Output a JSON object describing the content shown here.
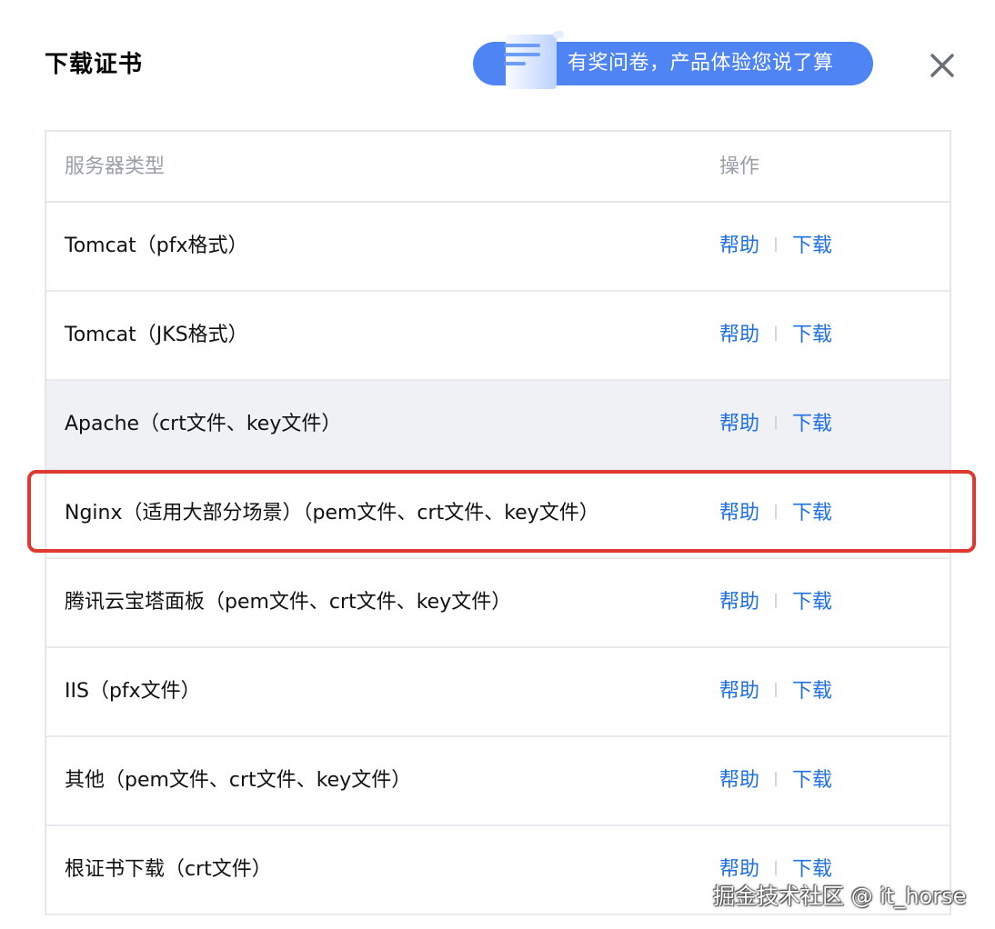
{
  "dialog": {
    "title": "下载证书",
    "survey_banner": "有奖问卷，产品体验您说了算",
    "close_icon": "close-icon"
  },
  "table": {
    "headers": {
      "server_type": "服务器类型",
      "action": "操作"
    },
    "rows": [
      {
        "name": "Tomcat（pfx格式）",
        "help": "帮助",
        "download": "下载"
      },
      {
        "name": "Tomcat（JKS格式）",
        "help": "帮助",
        "download": "下载"
      },
      {
        "name": "Apache（crt文件、key文件）",
        "help": "帮助",
        "download": "下载"
      },
      {
        "name": "Nginx（适用大部分场景）（pem文件、crt文件、key文件）",
        "help": "帮助",
        "download": "下载"
      },
      {
        "name": "腾讯云宝塔面板（pem文件、crt文件、key文件）",
        "help": "帮助",
        "download": "下载"
      },
      {
        "name": "IIS（pfx文件）",
        "help": "帮助",
        "download": "下载"
      },
      {
        "name": "其他（pem文件、crt文件、key文件）",
        "help": "帮助",
        "download": "下载"
      },
      {
        "name": "根证书下载（crt文件）",
        "help": "帮助",
        "download": "下载"
      }
    ]
  },
  "watermark": "掘金技术社区 @ it_horse",
  "colors": {
    "link": "#1f6fe5",
    "banner": "#4f84f5",
    "highlight": "#e03a30",
    "hover_row": "#eff1f4"
  }
}
